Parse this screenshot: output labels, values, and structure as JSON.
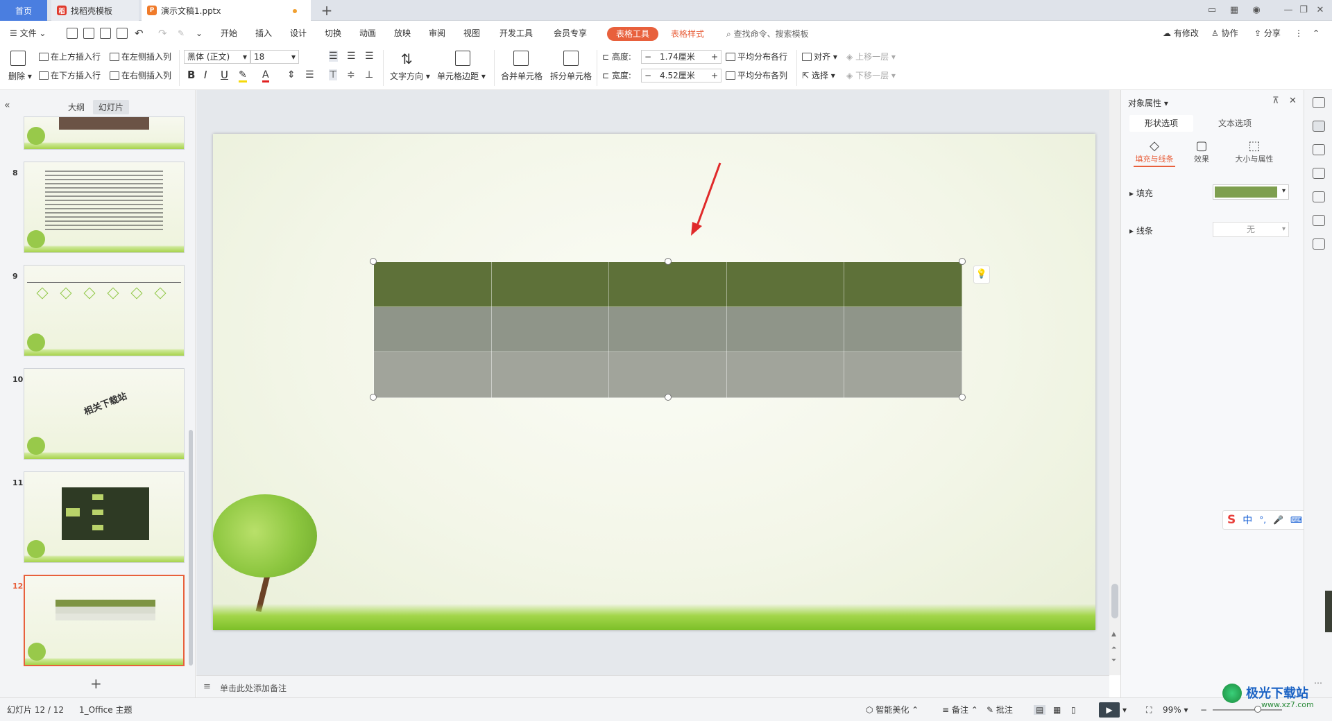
{
  "tabs": {
    "home": "首页",
    "template": "找稻壳模板",
    "doc": "演示文稿1.pptx"
  },
  "menu": {
    "file": "文件",
    "items": [
      "开始",
      "插入",
      "设计",
      "切换",
      "动画",
      "放映",
      "审阅",
      "视图",
      "开发工具",
      "会员专享"
    ],
    "table_tools": "表格工具",
    "table_style": "表格样式",
    "search": "查找命令、搜索模板",
    "modified": "有修改",
    "collab": "协作",
    "share": "分享"
  },
  "ribbon": {
    "delete": "删除",
    "insert_above": "在上方插入行",
    "insert_below": "在下方插入行",
    "insert_left": "在左侧插入列",
    "insert_right": "在右侧插入列",
    "font": "黑体 (正文)",
    "font_size": "18",
    "text_direction": "文字方向",
    "cell_margin": "单元格边距",
    "merge": "合并单元格",
    "split": "拆分单元格",
    "height_label": "高度:",
    "height_value": "1.74厘米",
    "width_label": "宽度:",
    "width_value": "4.52厘米",
    "dist_rows": "平均分布各行",
    "dist_cols": "平均分布各列",
    "align": "对齐",
    "select": "选择",
    "bring_forward": "上移一层",
    "send_backward": "下移一层"
  },
  "left_pane": {
    "outline_tab": "大纲",
    "slides_tab": "幻灯片",
    "thumb_numbers": [
      "8",
      "9",
      "10",
      "11",
      "12"
    ],
    "slide10_text": "相关下载站"
  },
  "notes_placeholder": "单击此处添加备注",
  "right_pane": {
    "title": "对象属性",
    "tab_shape": "形状选项",
    "tab_text": "文本选项",
    "sub_fill_line": "填充与线条",
    "sub_effect": "效果",
    "sub_size": "大小与属性",
    "fill_label": "填充",
    "line_label": "线条",
    "line_value": "无",
    "fill_color": "#7e9f4f"
  },
  "status": {
    "slide_info": "幻灯片 12 / 12",
    "theme": "1_Office 主题",
    "beautify": "智能美化",
    "notes": "备注",
    "comments": "批注",
    "zoom": "99%"
  },
  "ime": {
    "lang": "中"
  },
  "watermark": {
    "site": "极光下载站",
    "url": "www.xz7.com"
  },
  "colors": {
    "accent": "#e8603c",
    "table_header": "#5e7139",
    "table_row1": "#8f9589",
    "table_row2": "#a1a49b"
  }
}
